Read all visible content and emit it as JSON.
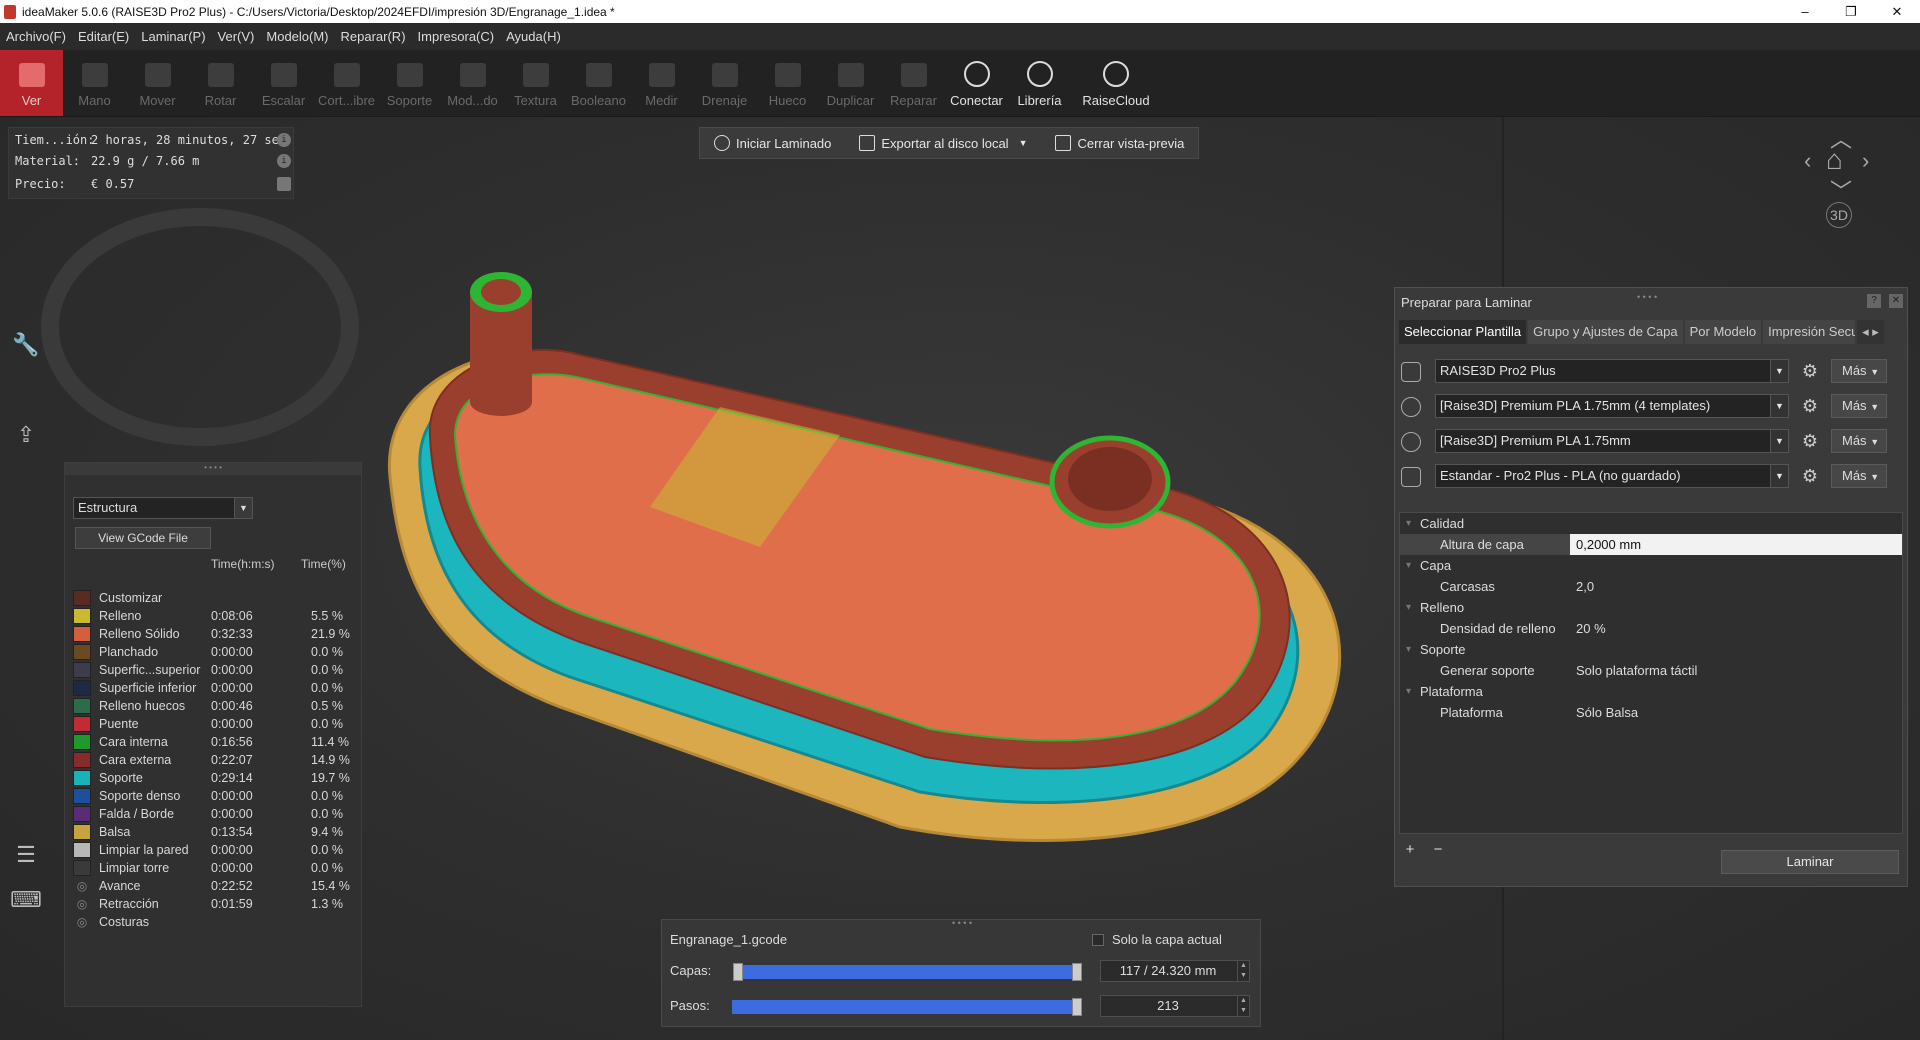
{
  "window": {
    "title": "ideaMaker 5.0.6 (RAISE3D Pro2 Plus) - C:/Users/Victoria/Desktop/2024EFDI/impresión 3D/Engranage_1.idea *",
    "minimize": "–",
    "maximize": "❐",
    "close": "✕"
  },
  "menu": [
    "Archivo(F)",
    "Editar(E)",
    "Laminar(P)",
    "Ver(V)",
    "Modelo(M)",
    "Reparar(R)",
    "Impresora(C)",
    "Ayuda(H)"
  ],
  "toolbar": {
    "tools": [
      "Ver",
      "Mano",
      "Mover",
      "Rotar",
      "Escalar",
      "Cort...ibre",
      "Soporte",
      "Mod...do",
      "Textura",
      "Booleano",
      "Medir",
      "Drenaje",
      "Hueco",
      "Duplicar",
      "Reparar"
    ],
    "conectar": "Conectar",
    "libreria": "Librería",
    "raisecloud": "RaiseCloud"
  },
  "info": {
    "time_label": "Tiem...ión:",
    "time_value": "2 horas, 28 minutos, 27 se",
    "material_label": "Material:",
    "material_value": "22.9 g / 7.66 m",
    "price_label": "Precio:",
    "price_value": "€ 0.57"
  },
  "actions": {
    "slice": "Iniciar Laminado",
    "export": "Exportar al disco local",
    "close_preview": "Cerrar vista-previa"
  },
  "legend": {
    "select_value": "Estructura",
    "gcode_button": "View GCode File",
    "head_time": "Time(h:m:s)",
    "head_pct": "Time(%)",
    "rows": [
      {
        "name": "Customizar",
        "time": "",
        "pct": "",
        "color": "#5b2a22"
      },
      {
        "name": "Relleno",
        "time": "0:08:06",
        "pct": "5.5 %",
        "color": "#c9b933"
      },
      {
        "name": "Relleno Sólido",
        "time": "0:32:33",
        "pct": "21.9 %",
        "color": "#d35f3d"
      },
      {
        "name": "Planchado",
        "time": "0:00:00",
        "pct": "0.0 %",
        "color": "#6b4a22"
      },
      {
        "name": "Superfic...superior",
        "time": "0:00:00",
        "pct": "0.0 %",
        "color": "#3c3c4c"
      },
      {
        "name": "Superficie inferior",
        "time": "0:00:00",
        "pct": "0.0 %",
        "color": "#1e2a44"
      },
      {
        "name": "Relleno huecos",
        "time": "0:00:46",
        "pct": "0.5 %",
        "color": "#2f6b4a"
      },
      {
        "name": "Puente",
        "time": "0:00:00",
        "pct": "0.0 %",
        "color": "#c22a36"
      },
      {
        "name": "Cara interna",
        "time": "0:16:56",
        "pct": "11.4 %",
        "color": "#1e9a2a"
      },
      {
        "name": "Cara externa",
        "time": "0:22:07",
        "pct": "14.9 %",
        "color": "#8a2b2b"
      },
      {
        "name": "Soporte",
        "time": "0:29:14",
        "pct": "19.7 %",
        "color": "#17b3b8"
      },
      {
        "name": "Soporte denso",
        "time": "0:00:00",
        "pct": "0.0 %",
        "color": "#1d4f9a"
      },
      {
        "name": "Falda / Borde",
        "time": "0:00:00",
        "pct": "0.0 %",
        "color": "#5a2c78"
      },
      {
        "name": "Balsa",
        "time": "0:13:54",
        "pct": "9.4 %",
        "color": "#c8a23d"
      },
      {
        "name": "Limpiar la pared",
        "time": "0:00:00",
        "pct": "0.0 %",
        "color": "#b8b8b8"
      },
      {
        "name": "Limpiar torre",
        "time": "0:00:00",
        "pct": "0.0 %",
        "color": "#3a3a3a"
      },
      {
        "name": "Avance",
        "time": "0:22:52",
        "pct": "15.4 %",
        "color": "icon"
      },
      {
        "name": "Retracción",
        "time": "0:01:59",
        "pct": "1.3 %",
        "color": "icon"
      },
      {
        "name": "Costuras",
        "time": "",
        "pct": "",
        "color": "icon"
      }
    ]
  },
  "prep": {
    "title": "Preparar para Laminar",
    "help": "?",
    "close": "✕",
    "tabs": [
      "Seleccionar Plantilla",
      "Grupo y Ajustes de Capa",
      "Por Modelo",
      "Impresión Secu"
    ],
    "printer": "RAISE3D Pro2 Plus",
    "filament1": "[Raise3D] Premium PLA 1.75mm (4 templates)",
    "filament2": "[Raise3D] Premium PLA 1.75mm",
    "template": "Estandar - Pro2 Plus - PLA (no guardado)",
    "more": "Más",
    "groups": {
      "calidad": "Calidad",
      "capa": "Capa",
      "relleno": "Relleno",
      "soporte": "Soporte",
      "plataforma": "Plataforma"
    },
    "props": {
      "layer_height_k": "Altura de capa",
      "layer_height_v": "0,2000 mm",
      "shells_k": "Carcasas",
      "shells_v": "2,0",
      "infill_k": "Densidad de relleno",
      "infill_v": "20 %",
      "support_k": "Generar soporte",
      "support_v": "Solo plataforma táctil",
      "platform_k": "Plataforma",
      "platform_v": "Sólo Balsa"
    },
    "plus": "+",
    "minus": "−",
    "slice_button": "Laminar"
  },
  "bottom": {
    "file": "Engranage_1.gcode",
    "only_layer": "Solo la capa actual",
    "layers_label": "Capas:",
    "layers_value": "117 / 24.320 mm",
    "steps_label": "Pasos:",
    "steps_value": "213",
    "layers_fraction": 1.0,
    "steps_fraction": 1.0
  },
  "colors": {
    "accent_red": "#b5232a",
    "slider_blue": "#3d6ce0",
    "model_orange": "#e06e4a",
    "model_wall": "#9a3f2d",
    "support_cyan": "#1cb6bf",
    "raft_yellow": "#d8a84a",
    "green_inner": "#2fb534"
  }
}
